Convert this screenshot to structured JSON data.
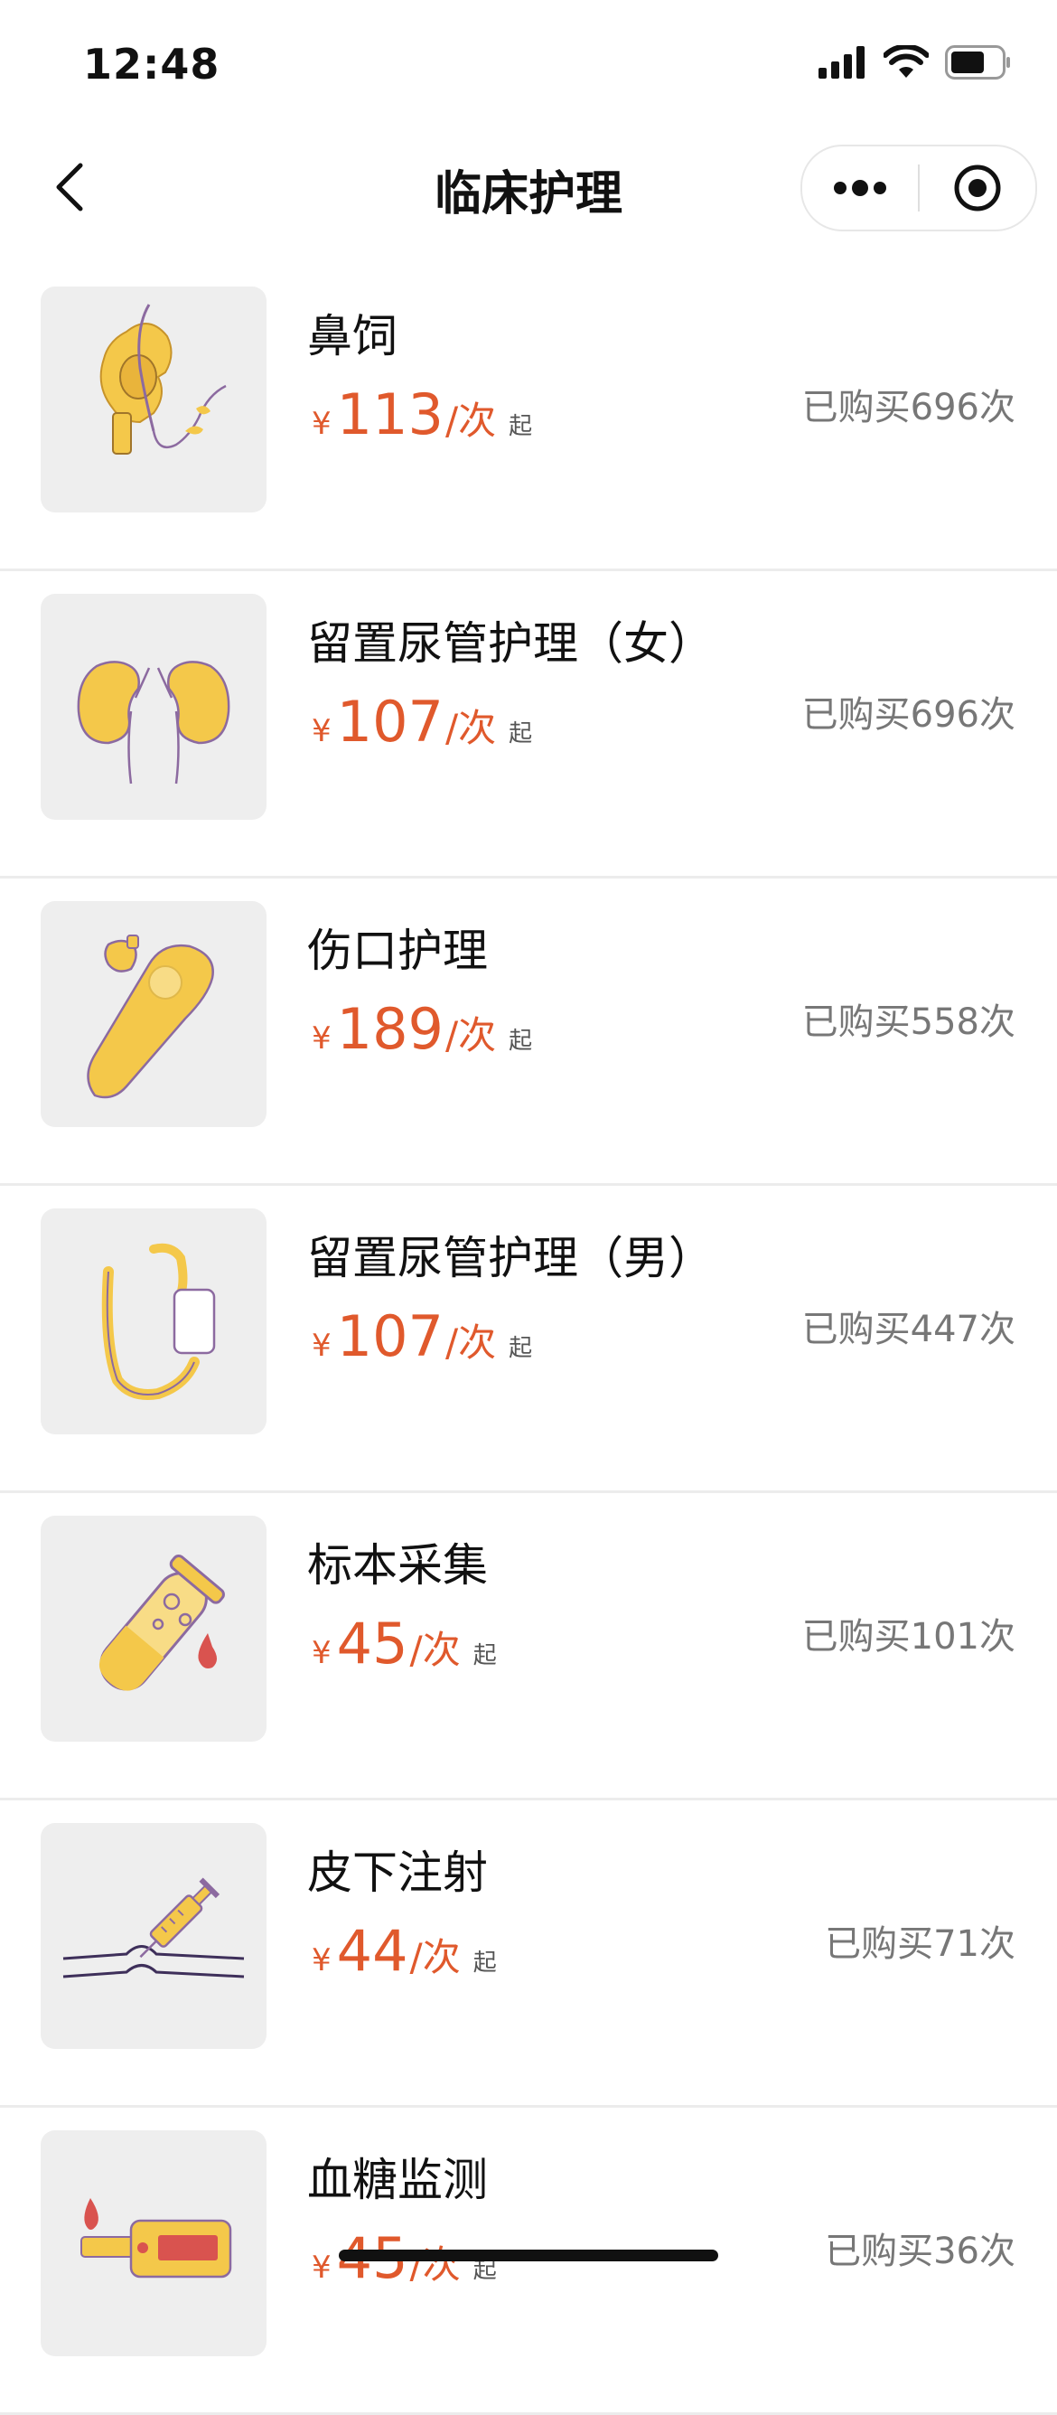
{
  "status": {
    "time": "12:48"
  },
  "nav": {
    "title": "临床护理"
  },
  "theme": {
    "price_color": "#e0592c",
    "illustration_color": "#f4c84a"
  },
  "items": [
    {
      "name": "鼻饲",
      "currency": "¥",
      "price": "113",
      "unit": "/次",
      "from": "起",
      "sold": "已购买696次",
      "icon": "nasal-feeding-icon"
    },
    {
      "name": "留置尿管护理（女）",
      "currency": "¥",
      "price": "107",
      "unit": "/次",
      "from": "起",
      "sold": "已购买696次",
      "icon": "kidney-icon"
    },
    {
      "name": "伤口护理",
      "currency": "¥",
      "price": "189",
      "unit": "/次",
      "from": "起",
      "sold": "已购买558次",
      "icon": "wound-care-icon"
    },
    {
      "name": "留置尿管护理（男）",
      "currency": "¥",
      "price": "107",
      "unit": "/次",
      "from": "起",
      "sold": "已购买447次",
      "icon": "catheter-bag-icon"
    },
    {
      "name": "标本采集",
      "currency": "¥",
      "price": "45",
      "unit": "/次",
      "from": "起",
      "sold": "已购买101次",
      "icon": "test-tube-icon"
    },
    {
      "name": "皮下注射",
      "currency": "¥",
      "price": "44",
      "unit": "/次",
      "from": "起",
      "sold": "已购买71次",
      "icon": "syringe-icon"
    },
    {
      "name": "血糖监测",
      "currency": "¥",
      "price": "45",
      "unit": "/次",
      "from": "起",
      "sold": "已购买36次",
      "icon": "glucose-meter-icon"
    }
  ]
}
